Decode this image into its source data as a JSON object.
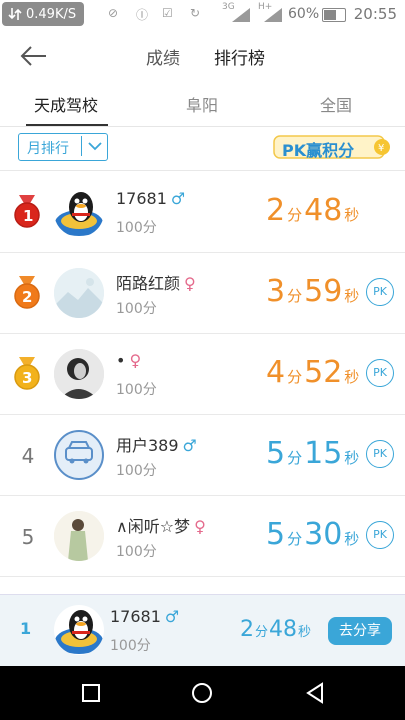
{
  "status_bar": {
    "speed": "0.49K/S",
    "network": "3G",
    "network2": "H+",
    "battery_percent": "60%",
    "time": "20:55"
  },
  "nav": {
    "tabs": [
      {
        "label": "成绩",
        "active": false
      },
      {
        "label": "排行榜",
        "active": true
      }
    ]
  },
  "sub_tabs": [
    {
      "label": "天成驾校",
      "active": true
    },
    {
      "label": "阜阳",
      "active": false
    },
    {
      "label": "全国",
      "active": false
    }
  ],
  "filter": {
    "period": "月排行",
    "pk_banner_text": "PK赢积分"
  },
  "rows": [
    {
      "rank": "1",
      "medal": "gold-red",
      "name": "17681",
      "gender": "male",
      "score": "100分",
      "min": "2",
      "min_unit": "分",
      "sec": "48",
      "sec_unit": "秒",
      "color": "#f0902a",
      "pk": false
    },
    {
      "rank": "2",
      "medal": "orange",
      "name": "陌路红颜",
      "gender": "female",
      "score": "100分",
      "min": "3",
      "min_unit": "分",
      "sec": "59",
      "sec_unit": "秒",
      "color": "#f0902a",
      "pk": true
    },
    {
      "rank": "3",
      "medal": "yellow",
      "name": "•",
      "gender": "female",
      "score": "100分",
      "min": "4",
      "min_unit": "分",
      "sec": "52",
      "sec_unit": "秒",
      "color": "#f0902a",
      "pk": true
    },
    {
      "rank": "4",
      "medal": "",
      "name": "用户389",
      "gender": "male",
      "score": "100分",
      "min": "5",
      "min_unit": "分",
      "sec": "15",
      "sec_unit": "秒",
      "color": "#3aa6d8",
      "pk": true
    },
    {
      "rank": "5",
      "medal": "",
      "name": "∧闲听☆梦",
      "gender": "female",
      "score": "100分",
      "min": "5",
      "min_unit": "分",
      "sec": "30",
      "sec_unit": "秒",
      "color": "#3aa6d8",
      "pk": true
    }
  ],
  "pk_label": "PK",
  "my_rank": {
    "rank": "1",
    "name": "17681",
    "gender": "male",
    "score": "100分",
    "min": "2",
    "min_unit": "分",
    "sec": "48",
    "sec_unit": "秒",
    "share_label": "去分享"
  },
  "gender_symbols": {
    "male": "♂",
    "female": "♀"
  },
  "colors": {
    "accent": "#3aa6d8",
    "orange": "#f0902a",
    "female": "#e46a8c"
  }
}
